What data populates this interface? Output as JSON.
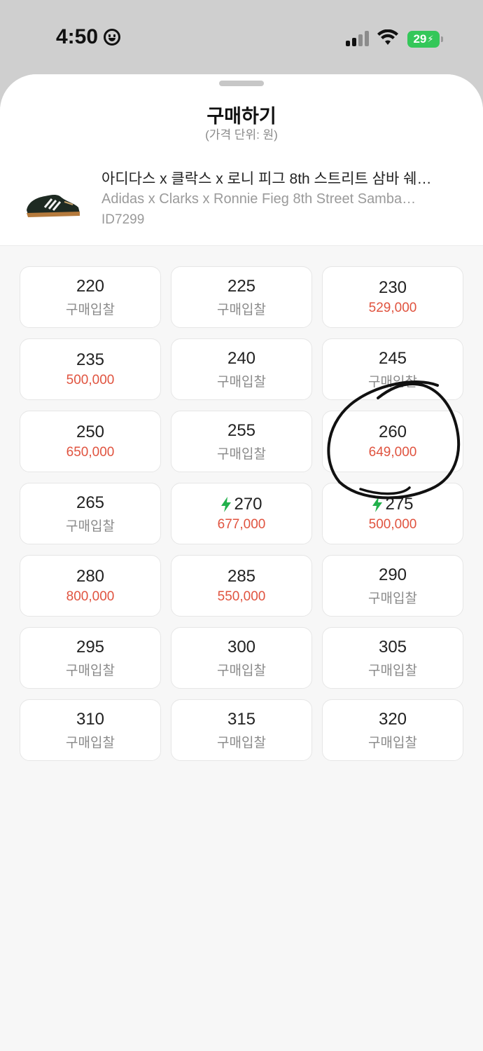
{
  "status_bar": {
    "time": "4:50",
    "battery": "29"
  },
  "sheet": {
    "title": "구매하기",
    "subtitle": "(가격 단위: 원)"
  },
  "product": {
    "name_ko": "아디다스 x 클락스 x 로니 피그 8th 스트리트 삼바 쉐…",
    "name_en": "Adidas x Clarks x Ronnie Fieg 8th Street Samba…",
    "model": "ID7299"
  },
  "colors": {
    "price_highlight": "#e0533f",
    "quick_delivery_icon": "#22b14c"
  },
  "sizes": [
    {
      "size": "220",
      "price": "구매입찰",
      "has_price": false,
      "quick": false
    },
    {
      "size": "225",
      "price": "구매입찰",
      "has_price": false,
      "quick": false
    },
    {
      "size": "230",
      "price": "529,000",
      "has_price": true,
      "quick": false
    },
    {
      "size": "235",
      "price": "500,000",
      "has_price": true,
      "quick": false
    },
    {
      "size": "240",
      "price": "구매입찰",
      "has_price": false,
      "quick": false
    },
    {
      "size": "245",
      "price": "구매입찰",
      "has_price": false,
      "quick": false
    },
    {
      "size": "250",
      "price": "650,000",
      "has_price": true,
      "quick": false
    },
    {
      "size": "255",
      "price": "구매입찰",
      "has_price": false,
      "quick": false
    },
    {
      "size": "260",
      "price": "649,000",
      "has_price": true,
      "quick": false
    },
    {
      "size": "265",
      "price": "구매입찰",
      "has_price": false,
      "quick": false
    },
    {
      "size": "270",
      "price": "677,000",
      "has_price": true,
      "quick": true
    },
    {
      "size": "275",
      "price": "500,000",
      "has_price": true,
      "quick": true
    },
    {
      "size": "280",
      "price": "800,000",
      "has_price": true,
      "quick": false
    },
    {
      "size": "285",
      "price": "550,000",
      "has_price": true,
      "quick": false
    },
    {
      "size": "290",
      "price": "구매입찰",
      "has_price": false,
      "quick": false
    },
    {
      "size": "295",
      "price": "구매입찰",
      "has_price": false,
      "quick": false
    },
    {
      "size": "300",
      "price": "구매입찰",
      "has_price": false,
      "quick": false
    },
    {
      "size": "305",
      "price": "구매입찰",
      "has_price": false,
      "quick": false
    },
    {
      "size": "310",
      "price": "구매입찰",
      "has_price": false,
      "quick": false
    },
    {
      "size": "315",
      "price": "구매입찰",
      "has_price": false,
      "quick": false
    },
    {
      "size": "320",
      "price": "구매입찰",
      "has_price": false,
      "quick": false
    }
  ]
}
